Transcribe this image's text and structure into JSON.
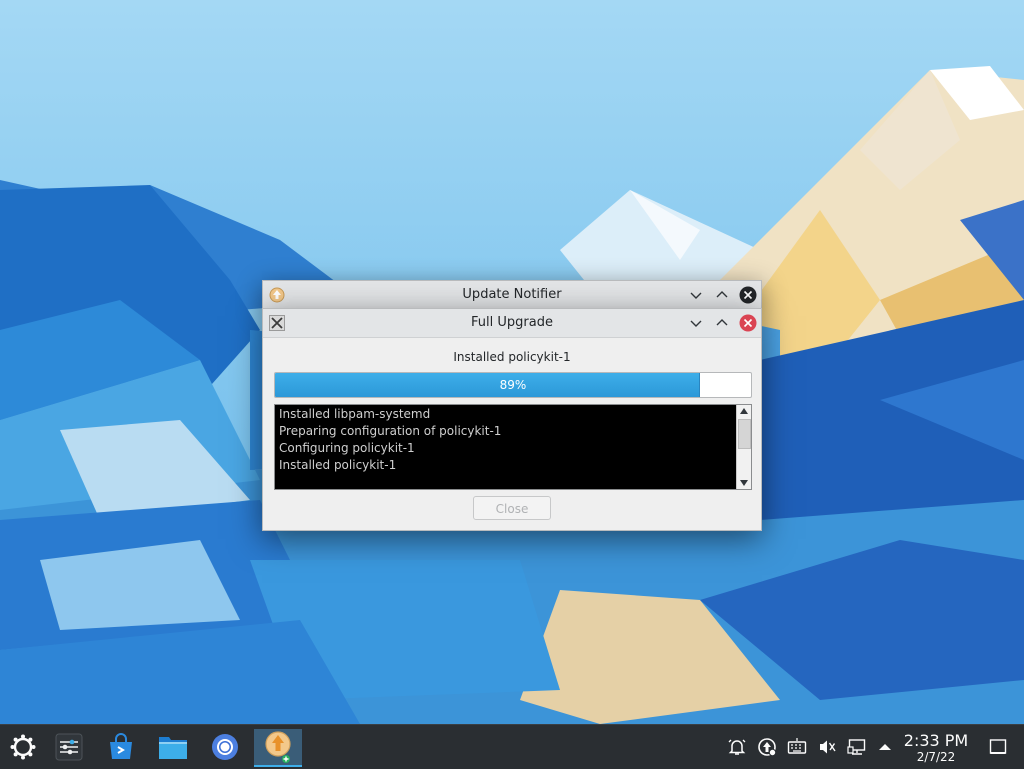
{
  "desktop": {
    "wallpaper": "mountain-polygon-wallpaper"
  },
  "windows": {
    "update_notifier": {
      "title": "Update Notifier",
      "icon": "update-notifier-icon"
    },
    "full_upgrade": {
      "title": "Full Upgrade",
      "icon": "app-x-icon",
      "status": "Installed policykit-1",
      "progress": {
        "value": 89,
        "label": "89%"
      },
      "log": [
        "Installed libpam-systemd",
        "Preparing configuration of policykit-1",
        "Configuring policykit-1",
        "Installed policykit-1"
      ],
      "close_label": "Close"
    }
  },
  "taskbar": {
    "launcher": "application-launcher-icon",
    "apps": [
      "system-settings-icon",
      "discover-icon",
      "file-manager-icon",
      "chromium-icon",
      "update-notifier-icon"
    ],
    "tray": [
      "notifications-icon",
      "updates-icon",
      "keyboard-icon",
      "volume-muted-icon",
      "network-icon",
      "expand-tray-icon"
    ],
    "clock": {
      "time": "2:33 PM",
      "date": "2/7/22"
    },
    "show_desktop": "show-desktop-icon"
  },
  "colors": {
    "accent": "#3daee9",
    "taskbar": "#2a2e32",
    "window_bg": "#efefef",
    "close_red": "#da4453"
  }
}
